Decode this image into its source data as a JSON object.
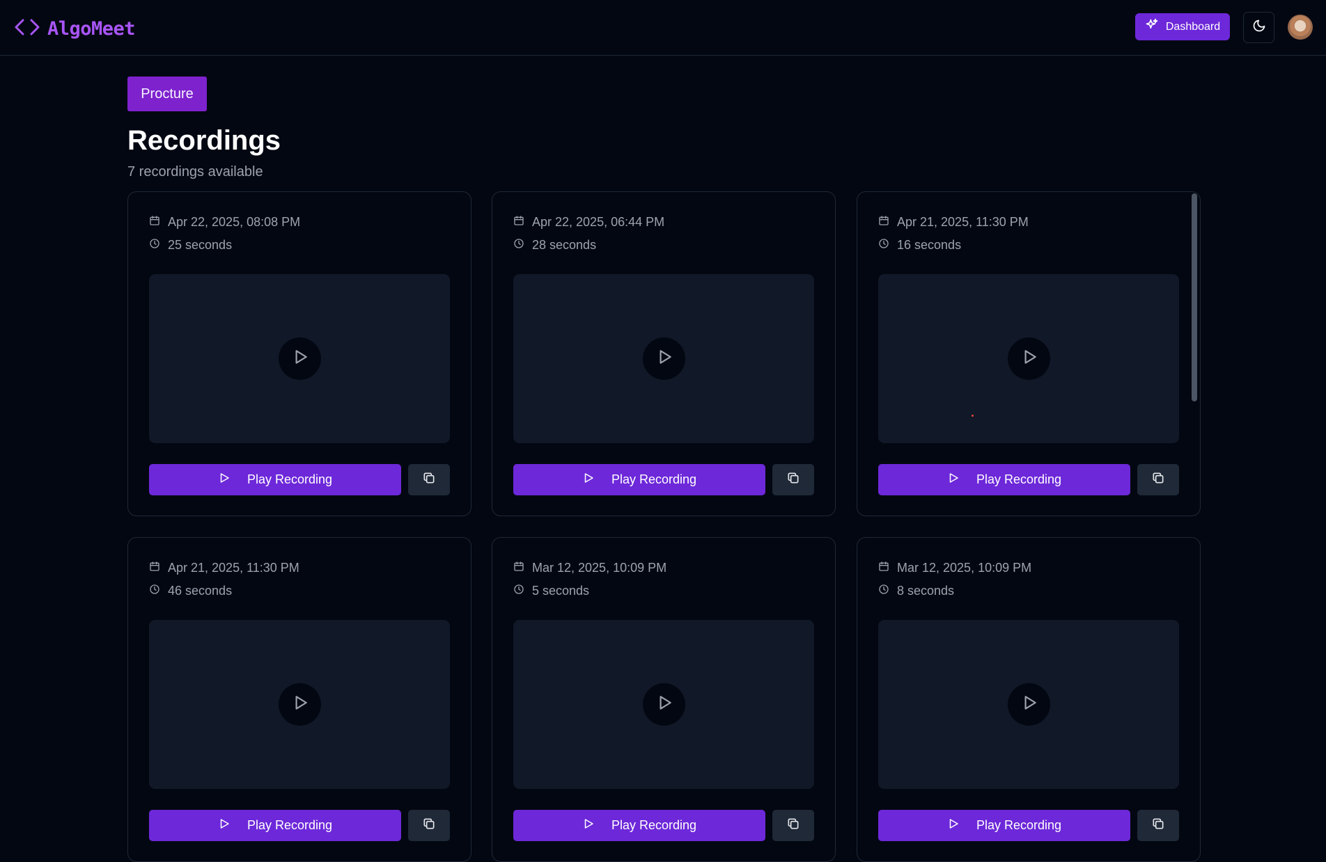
{
  "header": {
    "brand": "AlgoMeet",
    "dashboard_label": "Dashboard",
    "icons": {
      "logo": "code-brackets-icon",
      "dashboard": "sparkles-icon",
      "theme": "moon-icon"
    }
  },
  "page": {
    "tag": "Procture",
    "title": "Recordings",
    "subtitle": "7 recordings available"
  },
  "recordings": [
    {
      "date": "Apr 22, 2025, 08:08 PM",
      "duration": "25 seconds",
      "play_label": "Play Recording"
    },
    {
      "date": "Apr 22, 2025, 06:44 PM",
      "duration": "28 seconds",
      "play_label": "Play Recording"
    },
    {
      "date": "Apr 21, 2025, 11:30 PM",
      "duration": "16 seconds",
      "play_label": "Play Recording"
    },
    {
      "date": "Apr 21, 2025, 11:30 PM",
      "duration": "46 seconds",
      "play_label": "Play Recording"
    },
    {
      "date": "Mar 12, 2025, 10:09 PM",
      "duration": "5 seconds",
      "play_label": "Play Recording"
    },
    {
      "date": "Mar 12, 2025, 10:09 PM",
      "duration": "8 seconds",
      "play_label": "Play Recording"
    }
  ],
  "colors": {
    "accent": "#6d28d9",
    "brand": "#a855f7",
    "background": "#030712"
  }
}
